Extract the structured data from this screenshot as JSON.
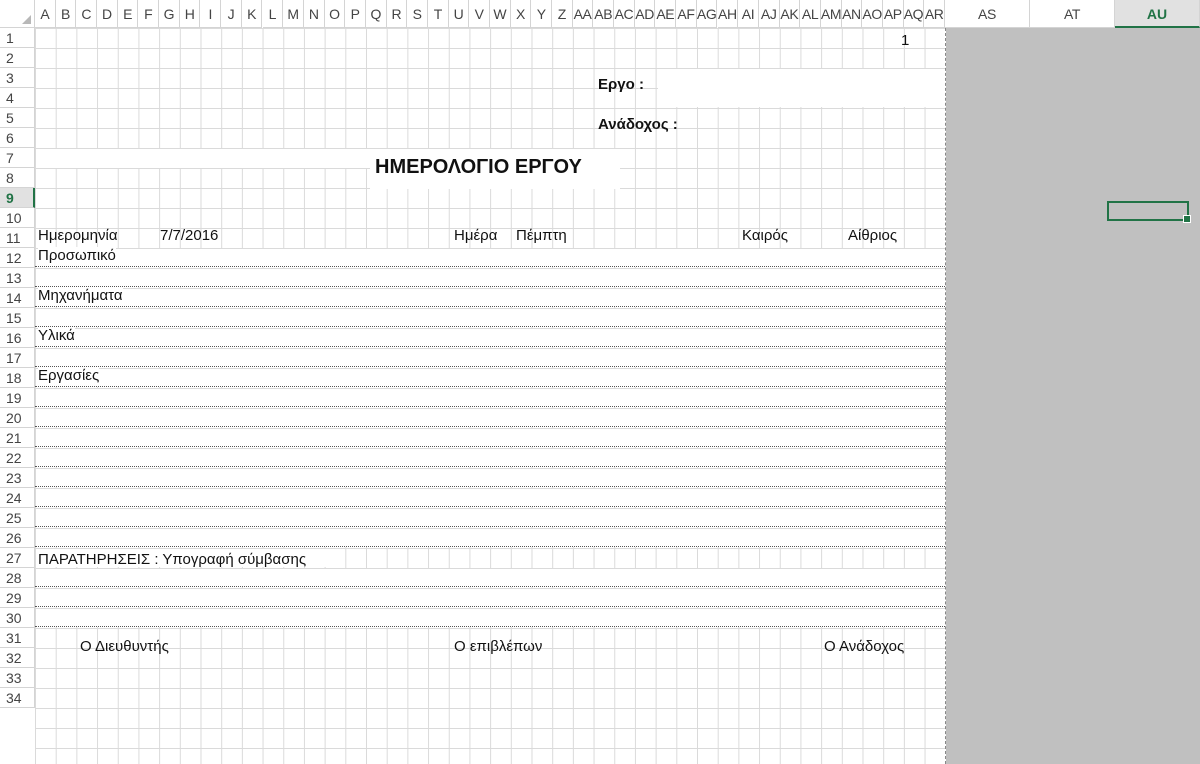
{
  "columns": {
    "narrow": [
      "A",
      "B",
      "C",
      "D",
      "E",
      "F",
      "G",
      "H",
      "I",
      "J",
      "K",
      "L",
      "M",
      "N",
      "O",
      "P",
      "Q",
      "R",
      "S",
      "T",
      "U",
      "V",
      "W",
      "X",
      "Y",
      "Z",
      "AA",
      "AB",
      "AC",
      "AD",
      "AE",
      "AF",
      "AG",
      "AH",
      "AI",
      "AJ",
      "AK",
      "AL",
      "AM",
      "AN",
      "AO",
      "AP",
      "AQ",
      "AR"
    ],
    "wide": [
      "AS",
      "AT",
      "AU"
    ],
    "selected": "AU"
  },
  "rows": {
    "numbers": [
      "1",
      "2",
      "3",
      "4",
      "5",
      "6",
      "7",
      "8",
      "9",
      "10",
      "11",
      "12",
      "13",
      "14",
      "15",
      "16",
      "17",
      "18",
      "19",
      "20",
      "21",
      "22",
      "23",
      "24",
      "25",
      "26",
      "27",
      "28",
      "29",
      "30",
      "31",
      "32",
      "33",
      "34"
    ],
    "selected": "9"
  },
  "cells": {
    "page_number": "1",
    "ergo_label": "Εργο :",
    "anadoxos_label": "Ανάδοχος :",
    "title": "ΗΜΕΡΟΛΟΓΙΟ ΕΡΓΟΥ",
    "date_label": "Ημερομηνία",
    "date_value": "7/7/2016",
    "day_label": "Ημέρα",
    "day_value": "Πέμπτη",
    "weather_label": "Καιρός",
    "weather_value": "Αίθριος",
    "personnel_label": "Προσωπικό",
    "machinery_label": "Μηχανήματα",
    "materials_label": "Υλικά",
    "works_label": "Εργασίες",
    "remarks": "ΠΑΡΑΤΗΡΗΣΕΙΣ : Υπογραφή σύμβασης",
    "director_label": "Ο Διευθυντής",
    "supervisor_label": "Ο επιβλέπων",
    "contractor_label": "Ο Ανάδοχος"
  }
}
